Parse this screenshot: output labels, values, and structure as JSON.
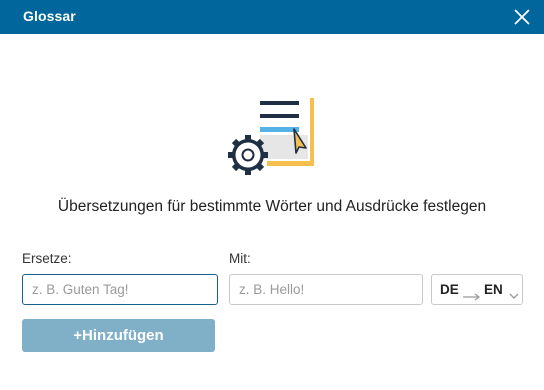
{
  "titlebar": {
    "title": "Glossar"
  },
  "heading": "Übersetzungen für bestimmte Wörter und Ausdrücke festlegen",
  "form": {
    "replace_label": "Ersetze:",
    "replace_placeholder": "z. B. Guten Tag!",
    "replace_value": "",
    "with_label": "Mit:",
    "with_placeholder": "z. B. Hello!",
    "with_value": ""
  },
  "language_pair": {
    "source": "DE",
    "target": "EN"
  },
  "add_button": {
    "label": "+Hinzufügen"
  },
  "icons": {
    "close": "close-icon",
    "illustration": "glossary-settings-illustration",
    "arrow": "arrow-right-icon",
    "dropdown": "chevron-down-icon"
  },
  "colors": {
    "titlebar": "#00669b",
    "button": "#7fb0c8",
    "focus_border": "#1a5f8e",
    "illustration_accent": "#f6c04e"
  }
}
